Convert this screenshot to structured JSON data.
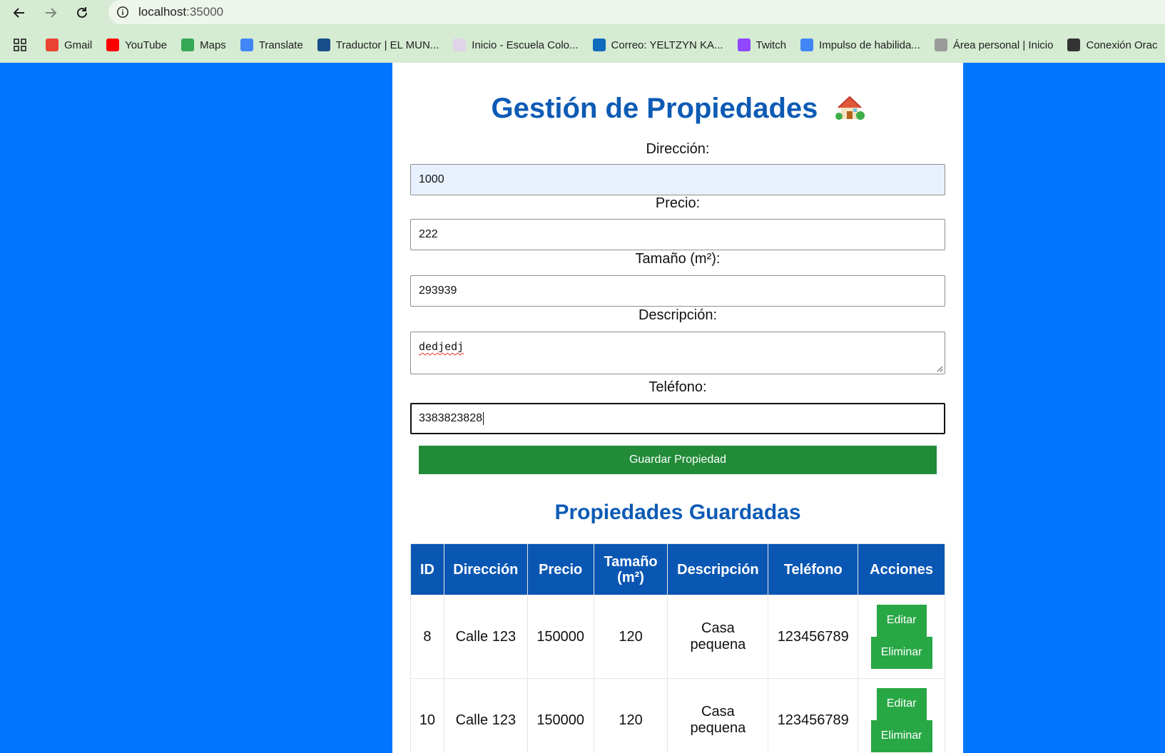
{
  "browser": {
    "url_host": "localhost",
    "url_port": ":35000",
    "bookmarks": [
      {
        "label": "Gmail",
        "icon": "gmail-icon",
        "color": "#ea4335"
      },
      {
        "label": "YouTube",
        "icon": "youtube-icon",
        "color": "#ff0000"
      },
      {
        "label": "Maps",
        "icon": "maps-icon",
        "color": "#34a853"
      },
      {
        "label": "Translate",
        "icon": "translate-icon",
        "color": "#4285f4"
      },
      {
        "label": "Traductor | EL MUN...",
        "icon": "globe-icon",
        "color": "#1a4e8a"
      },
      {
        "label": "Inicio - Escuela Colo...",
        "icon": "page-icon",
        "color": "#e0d4e8"
      },
      {
        "label": "Correo: YELTZYN KA...",
        "icon": "outlook-icon",
        "color": "#0f6cbd"
      },
      {
        "label": "Twitch",
        "icon": "twitch-icon",
        "color": "#9146ff"
      },
      {
        "label": "Impulso de habilida...",
        "icon": "google-cloud-icon",
        "color": "#4285f4"
      },
      {
        "label": "Área personal | Inicio",
        "icon": "moodle-icon",
        "color": "#9a9a9a"
      },
      {
        "label": "Conexión Orac",
        "icon": "world-icon",
        "color": "#333333"
      }
    ]
  },
  "page": {
    "title": "Gestión de Propiedades",
    "form": {
      "direccion_label": "Dirección:",
      "direccion_value": "1000",
      "precio_label": "Precio:",
      "precio_value": "222",
      "tamano_label": "Tamaño (m²):",
      "tamano_value": "293939",
      "descripcion_label": "Descripción:",
      "descripcion_value": "dedjedj",
      "telefono_label": "Teléfono:",
      "telefono_value": "3383823828",
      "save_label": "Guardar Propiedad"
    },
    "list_title": "Propiedades Guardadas",
    "table": {
      "headers": [
        "ID",
        "Dirección",
        "Precio",
        "Tamaño (m²)",
        "Descripción",
        "Teléfono",
        "Acciones"
      ],
      "rows": [
        {
          "id": "8",
          "direccion": "Calle 123",
          "precio": "150000",
          "tamano": "120",
          "descripcion": "Casa pequena",
          "telefono": "123456789"
        },
        {
          "id": "10",
          "direccion": "Calle 123",
          "precio": "150000",
          "tamano": "120",
          "descripcion": "Casa pequena",
          "telefono": "123456789"
        }
      ],
      "edit_label": "Editar",
      "delete_label": "Eliminar"
    }
  },
  "colors": {
    "page_bg": "#0075ff",
    "heading": "#0d5bb5",
    "table_header": "#0a57b3",
    "save_button": "#228b38",
    "action_button": "#28a745"
  }
}
